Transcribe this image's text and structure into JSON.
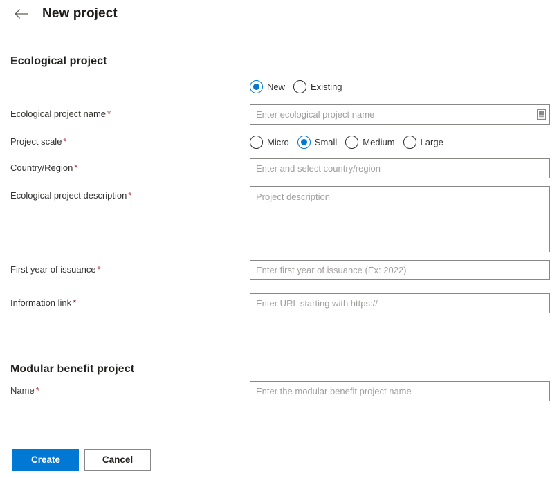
{
  "header": {
    "back_icon": "arrow-left-icon",
    "title": "New project"
  },
  "sections": [
    {
      "id": "ecological-project",
      "heading": "Ecological project"
    },
    {
      "id": "modular-benefit-project",
      "heading": "Modular benefit project"
    }
  ],
  "ecological": {
    "mode": {
      "options": [
        {
          "label": "New",
          "checked": true
        },
        {
          "label": "Existing",
          "checked": false
        }
      ]
    },
    "name": {
      "label": "Ecological project name",
      "required": "*",
      "placeholder": "Enter ecological project name",
      "value": "",
      "affix_icon": "document-picker-icon"
    },
    "scale": {
      "label": "Project scale",
      "required": "*",
      "options": [
        {
          "label": "Micro",
          "checked": false
        },
        {
          "label": "Small",
          "checked": true
        },
        {
          "label": "Medium",
          "checked": false
        },
        {
          "label": "Large",
          "checked": false
        }
      ]
    },
    "country": {
      "label": "Country/Region",
      "required": "*",
      "placeholder": "Enter and select country/region",
      "value": ""
    },
    "description": {
      "label": "Ecological project description",
      "required": "*",
      "placeholder": "Project description",
      "value": ""
    },
    "first_year": {
      "label": "First year of issuance",
      "required": "*",
      "placeholder": "Enter first year of issuance (Ex: 2022)",
      "value": ""
    },
    "info_link": {
      "label": "Information link",
      "required": "*",
      "placeholder": "Enter URL starting with https://",
      "value": ""
    }
  },
  "modular": {
    "name": {
      "label": "Name",
      "required": "*",
      "placeholder": "Enter the modular benefit project name",
      "value": ""
    }
  },
  "footer": {
    "create_label": "Create",
    "cancel_label": "Cancel"
  },
  "colors": {
    "accent": "#0078d4",
    "required": "#a4262c",
    "border": "#8a8886",
    "placeholder": "#a19f9d",
    "divider": "#edebe9"
  }
}
